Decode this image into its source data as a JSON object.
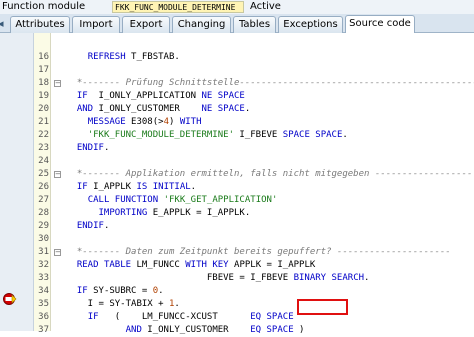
{
  "header": {
    "label": "Function module",
    "name": "FKK_FUNC_MODULE_DETERMINE",
    "status": "Active"
  },
  "tabs": [
    {
      "label": "Attributes"
    },
    {
      "label": "Import"
    },
    {
      "label": "Export"
    },
    {
      "label": "Changing"
    },
    {
      "label": "Tables"
    },
    {
      "label": "Exceptions"
    },
    {
      "label": "Source code"
    }
  ],
  "active_tab": "Source code",
  "code": {
    "lines": [
      {
        "num": "16",
        "text": "    REFRESH T_FBSTAB."
      },
      {
        "num": "17",
        "text": ""
      },
      {
        "num": "18",
        "text": "  *------- Prüfung Schnittstelle-----------------------------------------------"
      },
      {
        "num": "19",
        "text": "  IF  I_ONLY_APPLICATION NE SPACE"
      },
      {
        "num": "20",
        "text": "  AND I_ONLY_CUSTOMER    NE SPACE."
      },
      {
        "num": "21",
        "text": "    MESSAGE E308(>4) WITH"
      },
      {
        "num": "22",
        "text": "    'FKK_FUNC_MODULE_DETERMINE' I_FBEVE SPACE SPACE."
      },
      {
        "num": "23",
        "text": "  ENDIF."
      },
      {
        "num": "24",
        "text": ""
      },
      {
        "num": "25",
        "text": "  *------- Applikation ermitteln, falls nicht mitgegeben ------------------"
      },
      {
        "num": "26",
        "text": "  IF I_APPLK IS INITIAL."
      },
      {
        "num": "27",
        "text": "    CALL FUNCTION 'FKK_GET_APPLICATION'"
      },
      {
        "num": "28",
        "text": "      IMPORTING E_APPLK = I_APPLK."
      },
      {
        "num": "29",
        "text": "  ENDIF."
      },
      {
        "num": "30",
        "text": ""
      },
      {
        "num": "31",
        "text": "  *------- Daten zum Zeitpunkt bereits gepuffert? ---------------------"
      },
      {
        "num": "32",
        "text": "  READ TABLE LM_FUNCC WITH KEY APPLK = I_APPLK"
      },
      {
        "num": "33",
        "text": "                          FBEVE = I_FBEVE BINARY SEARCH."
      },
      {
        "num": "34",
        "text": "  IF SY-SUBRC = 0."
      },
      {
        "num": "35",
        "text": "    I = SY-TABIX + 1."
      },
      {
        "num": "36",
        "text": "    IF   (    LM_FUNCC-XCUST      EQ SPACE"
      },
      {
        "num": "37",
        "text": "           AND I_ONLY_CUSTOMER    EQ SPACE )"
      }
    ]
  },
  "icons": {
    "breakpoint": "breakpoint-icon",
    "fold": "fold-toggle-icon"
  },
  "colors": {
    "keyword": "#0000c8",
    "comment": "#7a7a7a",
    "string": "#1b7b1b",
    "highlight_box": "#e01010"
  }
}
